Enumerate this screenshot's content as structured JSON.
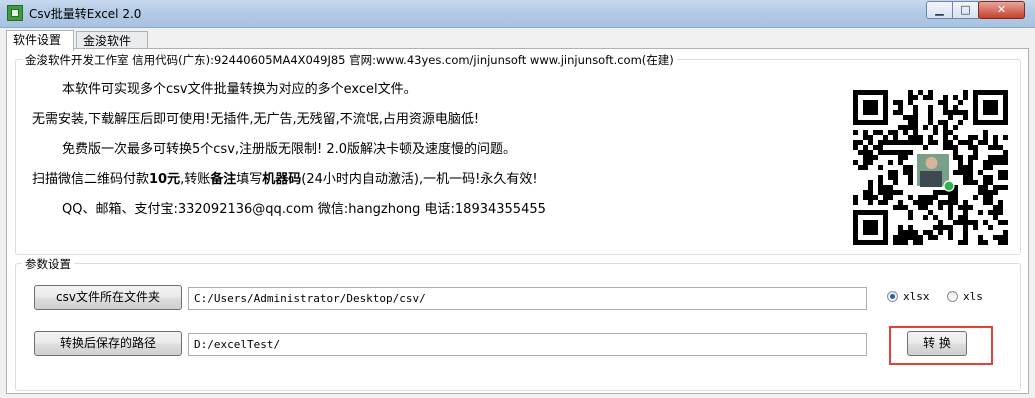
{
  "window": {
    "title": "Csv批量转Excel 2.0",
    "min_glyph": "▁",
    "max_glyph": "□",
    "close_glyph": "✕"
  },
  "tabs": [
    {
      "label": "软件设置"
    },
    {
      "label": "金浚软件"
    }
  ],
  "info_group": {
    "legend": "金浚软件开发工作室 信用代码(广东):92440605MA4X049J85 官网:www.43yes.com/jinjunsoft  www.jinjunsoft.com(在建)",
    "line1": "本软件可实现多个csv文件批量转换为对应的多个excel文件。",
    "line2": "无需安装,下载解压后即可使用!无插件,无广告,无残留,不流氓,占用资源电脑低!",
    "line3": "免费版一次最多可转换5个csv,注册版无限制! 2.0版解决卡顿及速度慢的问题。",
    "line4": {
      "part1": "扫描微信二维码付款",
      "amount": "10元",
      "part2": ",转账",
      "note": "备注",
      "part3": "填写",
      "code": "机器码",
      "part4": "(24小时内自动激活),一机一码!永久有效!"
    },
    "line5": "QQ、邮箱、支付宝:332092136@qq.com    微信:hangzhong    电话:18934355455"
  },
  "params_group": {
    "legend": "参数设置",
    "csv_folder_button": "csv文件所在文件夹",
    "csv_folder_value": "C:/Users/Administrator/Desktop/csv/",
    "save_path_button": "转换后保存的路径",
    "save_path_value": "D:/excelTest/",
    "format_options": [
      {
        "label": "xlsx",
        "selected": true
      },
      {
        "label": "xls",
        "selected": false
      }
    ],
    "convert_button": "转 换"
  },
  "colors": {
    "highlight": "#e0433a",
    "radio_selected": "#2a5ea8"
  }
}
